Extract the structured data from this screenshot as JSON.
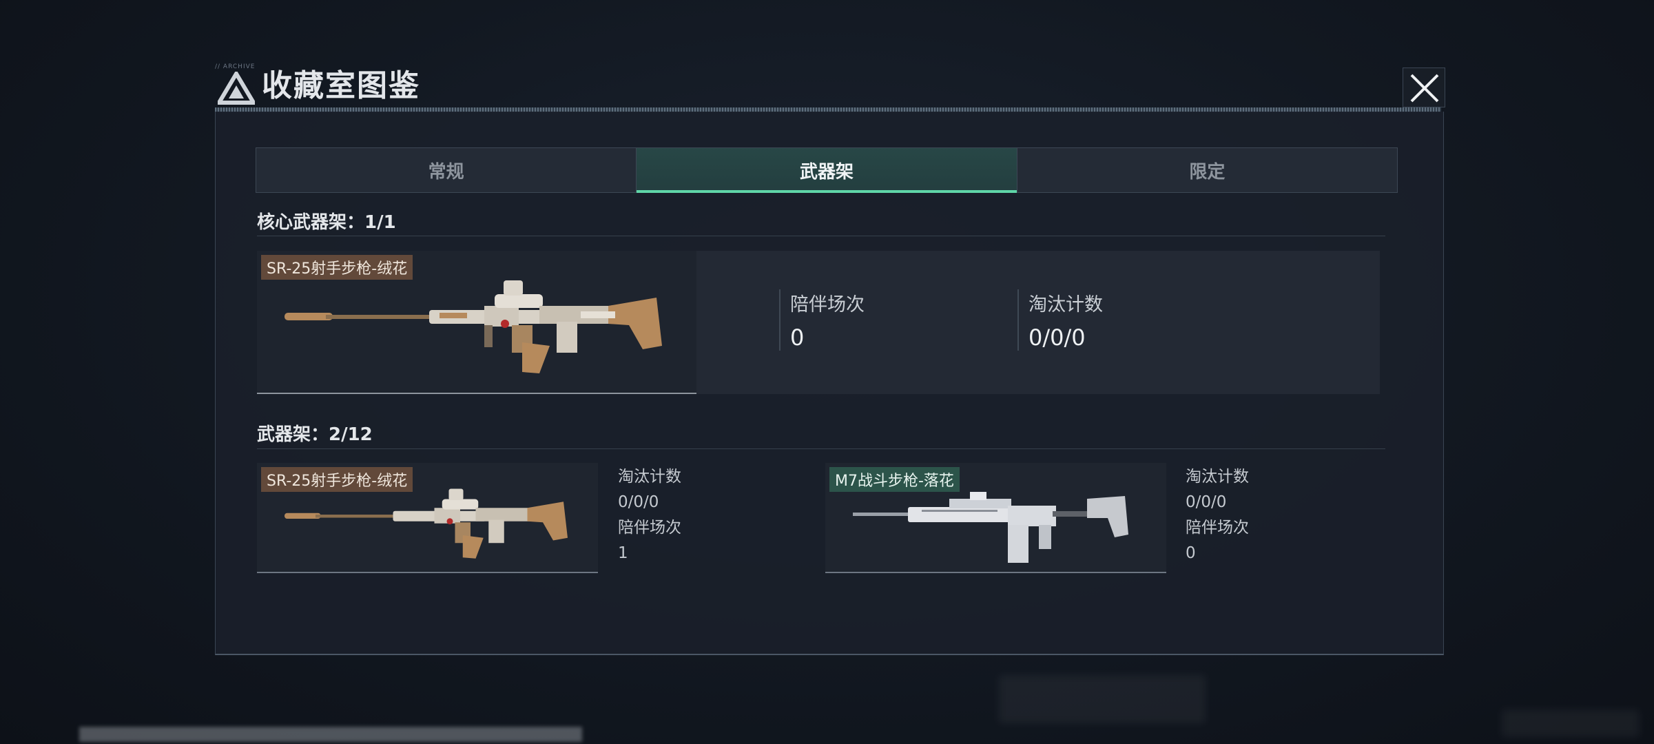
{
  "dialog": {
    "title": "收藏室图鉴",
    "close_icon": "close-icon"
  },
  "tabs": [
    {
      "label": "常规",
      "active": false
    },
    {
      "label": "武器架",
      "active": true
    },
    {
      "label": "限定",
      "active": false
    }
  ],
  "core_rack": {
    "title": "核心武器架：1/1",
    "item": {
      "name": "SR-25射手步枪-绒花",
      "stats": [
        {
          "label": "陪伴场次",
          "value": "0"
        },
        {
          "label": "淘汰计数",
          "value": "0/0/0"
        }
      ]
    }
  },
  "weapon_rack": {
    "title": "武器架：2/12",
    "items": [
      {
        "name": "SR-25射手步枪-绒花",
        "elim_label": "淘汰计数",
        "elim_value": "0/0/0",
        "match_label": "陪伴场次",
        "match_value": "1"
      },
      {
        "name": "M7战斗步枪-落花",
        "elim_label": "淘汰计数",
        "elim_value": "0/0/0",
        "match_label": "陪伴场次",
        "match_value": "0"
      }
    ]
  },
  "colors": {
    "accent": "#5fd6a8",
    "tag_brown": "#6e503c",
    "tag_green": "#2e5a4e"
  }
}
